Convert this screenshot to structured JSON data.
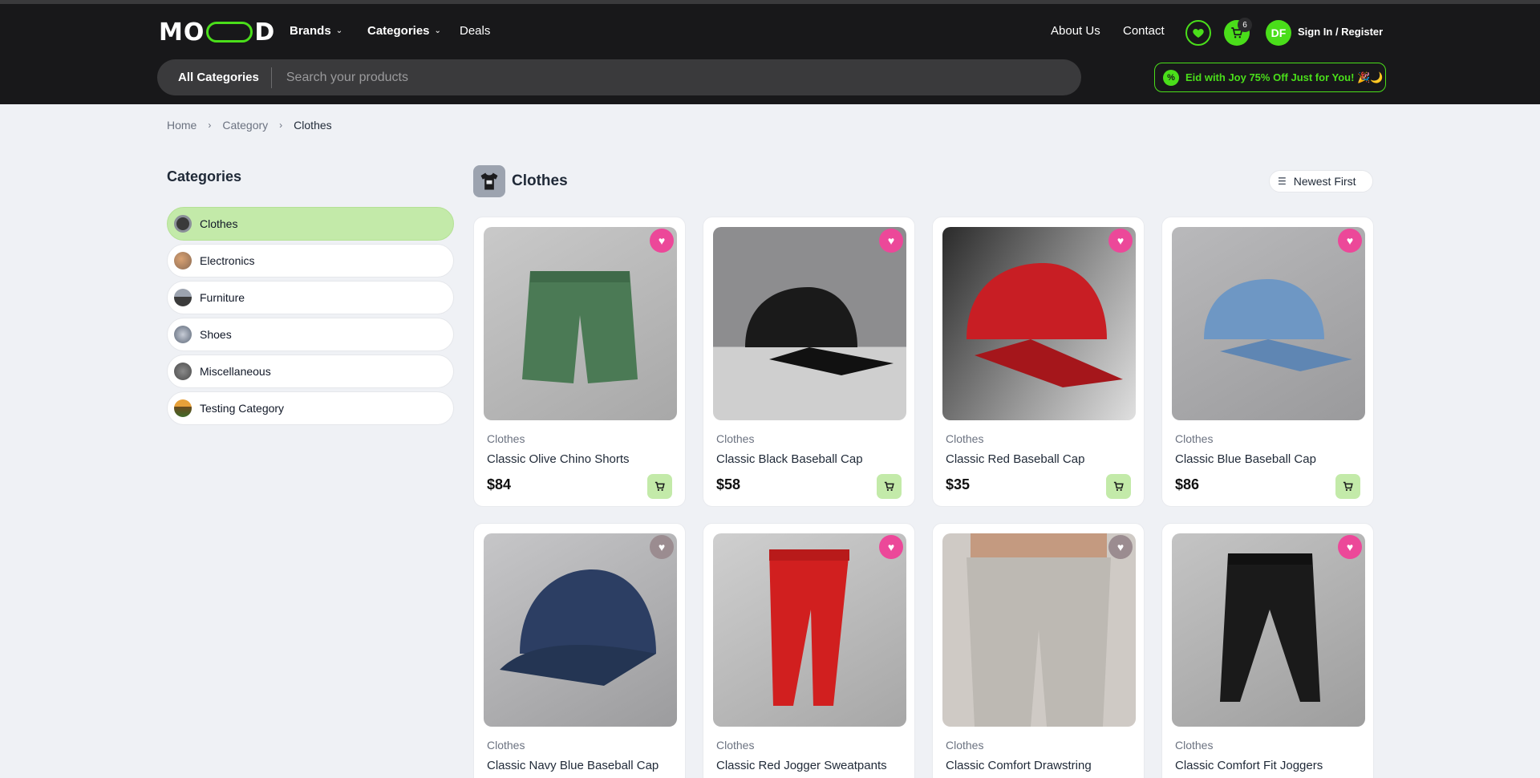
{
  "brand": {
    "logo_left": "MO",
    "logo_right": "D",
    "accent": "#4ade1a"
  },
  "nav": {
    "brands": "Brands",
    "categories": "Categories",
    "deals": "Deals",
    "about": "About Us",
    "contact": "Contact"
  },
  "header": {
    "cart_count": "6",
    "avatar_initials": "DF",
    "signin": "Sign In / Register"
  },
  "search": {
    "all_categories": "All Categories",
    "placeholder": "Search your products"
  },
  "promo": {
    "icon": "%",
    "text": "Eid with Joy 75% Off Just for You! 🎉🌙"
  },
  "breadcrumb": {
    "home": "Home",
    "category": "Category",
    "current": "Clothes"
  },
  "sidebar": {
    "title": "Categories",
    "items": [
      {
        "label": "Clothes",
        "active": true
      },
      {
        "label": "Electronics",
        "active": false
      },
      {
        "label": "Furniture",
        "active": false
      },
      {
        "label": "Shoes",
        "active": false
      },
      {
        "label": "Miscellaneous",
        "active": false
      },
      {
        "label": "Testing Category",
        "active": false
      }
    ]
  },
  "main": {
    "title": "Clothes",
    "sort_label": "Newest First",
    "products": [
      {
        "category": "Clothes",
        "name": "Classic Olive Chino Shorts",
        "price": "$84",
        "favorited": true
      },
      {
        "category": "Clothes",
        "name": "Classic Black Baseball Cap",
        "price": "$58",
        "favorited": true
      },
      {
        "category": "Clothes",
        "name": "Classic Red Baseball Cap",
        "price": "$35",
        "favorited": true
      },
      {
        "category": "Clothes",
        "name": "Classic Blue Baseball Cap",
        "price": "$86",
        "favorited": true
      },
      {
        "category": "Clothes",
        "name": "Classic Navy Blue Baseball Cap",
        "price": "",
        "favorited": false
      },
      {
        "category": "Clothes",
        "name": "Classic Red Jogger Sweatpants",
        "price": "",
        "favorited": true
      },
      {
        "category": "Clothes",
        "name": "Classic Comfort Drawstring",
        "price": "",
        "favorited": false
      },
      {
        "category": "Clothes",
        "name": "Classic Comfort Fit Joggers",
        "price": "",
        "favorited": true
      }
    ]
  }
}
